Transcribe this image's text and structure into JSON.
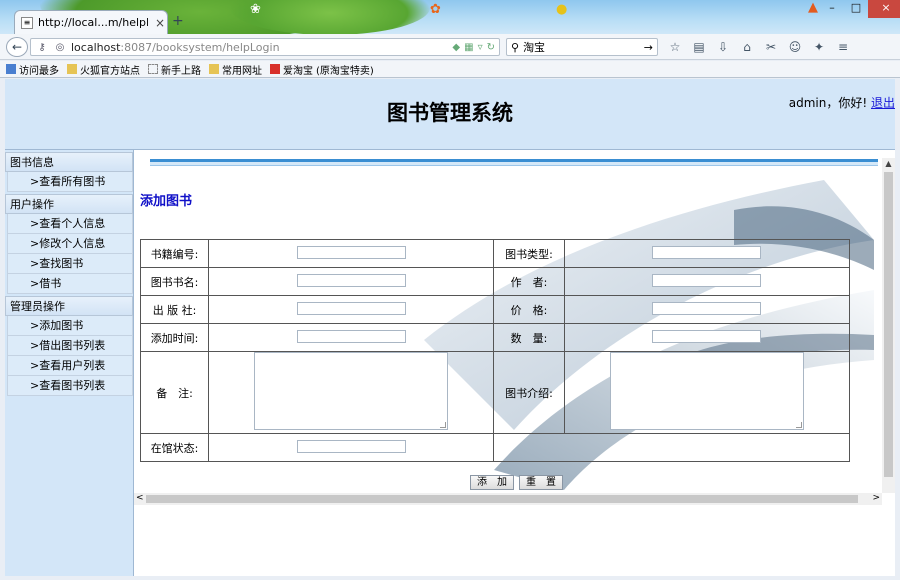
{
  "browser": {
    "tab_title": "http://local...m/helpLogin",
    "new_tab": "+",
    "url_host": "localhost",
    "url_rest": ":8087/booksystem/helpLogin",
    "search_value": "淘宝",
    "bookmarks": [
      "访问最多",
      "火狐官方站点",
      "新手上路",
      "常用网址",
      "爱淘宝",
      "(原淘宝特卖)"
    ]
  },
  "header": {
    "title": "图书管理系统",
    "user_greeting": "admin，你好!",
    "logout": "退出"
  },
  "sidebar": {
    "groups": [
      {
        "label": "图书信息",
        "items": [
          ">查看所有图书"
        ]
      },
      {
        "label": "用户操作",
        "items": [
          ">查看个人信息",
          ">修改个人信息",
          ">查找图书",
          ">借书"
        ]
      },
      {
        "label": "管理员操作",
        "items": [
          ">添加图书",
          ">借出图书列表",
          ">查看用户列表",
          ">查看图书列表"
        ]
      }
    ]
  },
  "form": {
    "title": "添加图书",
    "labels": {
      "book_no": "书籍编号:",
      "book_type": "图书类型:",
      "book_name": "图书书名:",
      "author": "作　者:",
      "publisher": "出 版 社:",
      "price": "价　格:",
      "add_time": "添加时间:",
      "quantity": "数　量:",
      "remark": "备　注:",
      "intro": "图书介绍:",
      "status": "在馆状态:"
    },
    "buttons": {
      "add": "添　加",
      "reset": "重　置"
    }
  }
}
